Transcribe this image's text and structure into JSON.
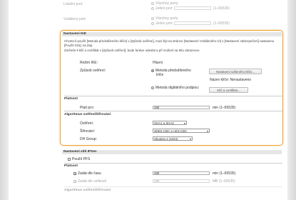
{
  "top": {
    "local_port_label": "Lokální port:",
    "local_all_ports": "Všechny porty",
    "local_single_port": "Jeden port",
    "local_port_range": "(1–65535)",
    "remote_port_label": "Vzdálený port:",
    "remote_all_ports": "Všechny porty",
    "remote_single_port": "Jeden port",
    "remote_port_range": "(1–65535)"
  },
  "ike": {
    "title": "Nastavení IKE",
    "description_1": "Chcete-li použít [Metoda předsdíleného klíče] v [Způsob ověření], musí být na stránce [Nastavení Vzdáleného UI] v [Nastavení zabezpečení] nastaveno [Použít SSL] na Zap.",
    "description_2": "Změníte-li klíč a certifikát v [Způsob ověření], bude funkce odeslat a při zrušení na této obrazovce.",
    "mode_label": "Režim IKE:",
    "mode_value": "Hlavní",
    "auth_label": "Způsob ověření:",
    "auth_psk_line1": "Metoda předsdíleného",
    "auth_psk_line2": "klíče",
    "psk_button": "Nastavení sdíleného klíče...",
    "key_name_label": "Název klíče:",
    "key_name_value": "Nenastaveno",
    "auth_sig": "Metoda digitálního podpisu:",
    "cert_button": "Klíč a certifikát...",
    "validity_heading": "Platnost",
    "valid_for_label": "Platí pro:",
    "valid_for_value": "480",
    "valid_for_unit": "min (1–65535)",
    "algo_heading": "Algoritmus ověření/šifrování",
    "auth_algo_label": "Ověření:",
    "auth_algo_value": "SHA1 a SHA2",
    "enc_label": "Šifrování:",
    "enc_value": "3DES-CBC a AES-CBC",
    "dh_label": "DH Group:",
    "dh_value": "Skupina 2 (1024)"
  },
  "ipsec": {
    "title": "Nastavení sítě IPSec",
    "pfs_label": "Použít PFS",
    "validity_heading": "Platnost",
    "time_label": "Zadat dle času",
    "time_value": "480",
    "time_unit": "min (1–65535)",
    "size_label": "Zadat dle velikosti",
    "size_value": "100",
    "size_unit": "MB (1–65535)",
    "algo_heading": "Algoritmus ověření/šifrování"
  }
}
